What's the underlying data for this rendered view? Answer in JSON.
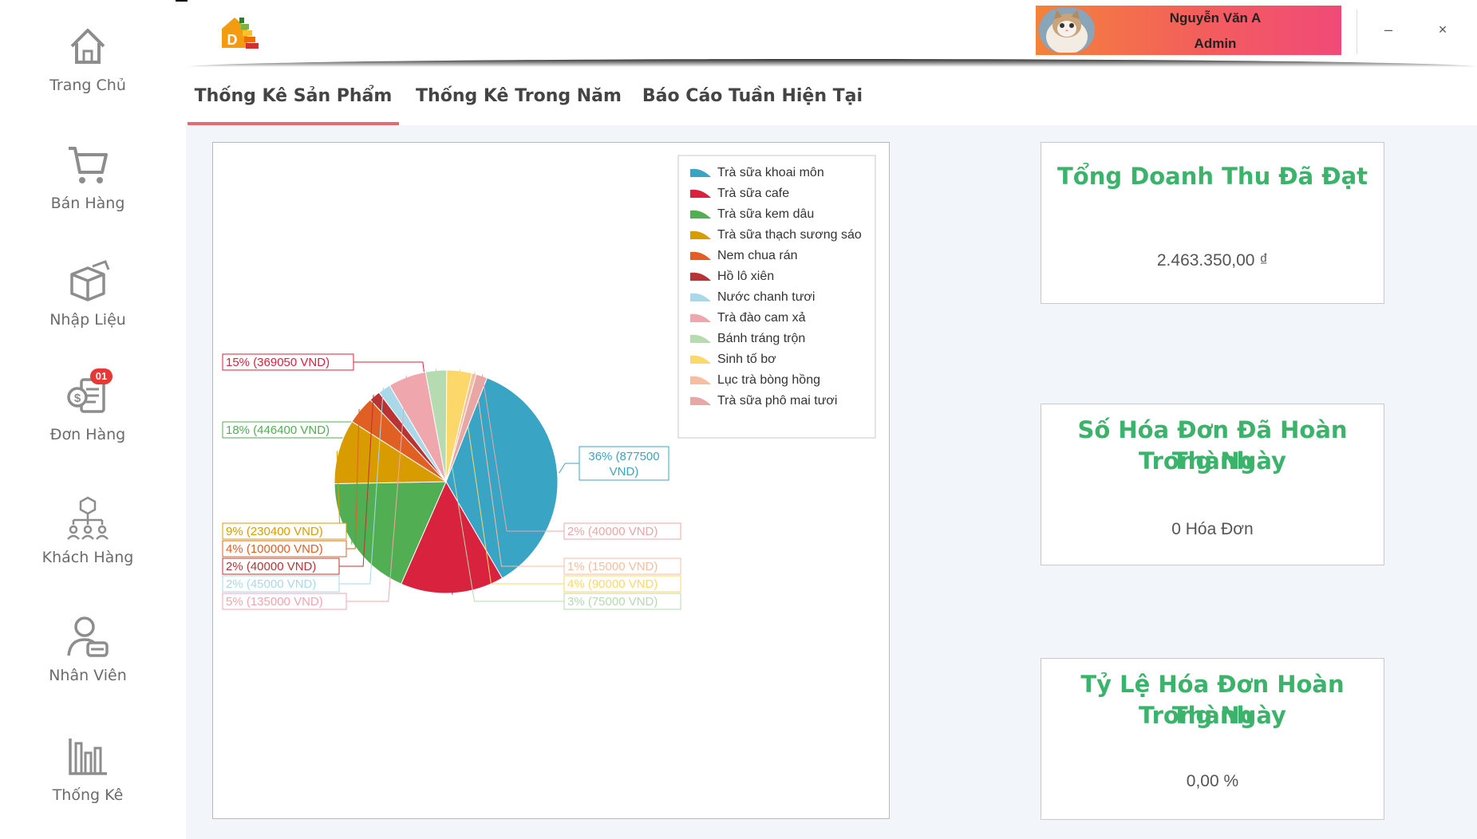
{
  "sidebar": {
    "items": [
      {
        "label": "Trang Chủ",
        "icon": "home-icon"
      },
      {
        "label": "Bán Hàng",
        "icon": "cart-icon"
      },
      {
        "label": "Nhập Liệu",
        "icon": "box-icon"
      },
      {
        "label": "Đơn Hàng",
        "icon": "invoice-icon",
        "badge": "01"
      },
      {
        "label": "Khách Hàng",
        "icon": "customers-icon"
      },
      {
        "label": "Nhân Viên",
        "icon": "employee-icon"
      },
      {
        "label": "Thống Kê",
        "icon": "statistics-icon"
      }
    ]
  },
  "header": {
    "user_name": "Nguyễn Văn A",
    "user_role": "Admin",
    "minimize_label": "–",
    "close_label": "×"
  },
  "tabs": [
    {
      "label": "Thống Kê Sản Phẩm",
      "active": true
    },
    {
      "label": "Thống Kê Trong Năm",
      "active": false
    },
    {
      "label": "Báo Cáo Tuần Hiện Tại",
      "active": false
    }
  ],
  "stats": {
    "revenue_title": "Tổng Doanh Thu Đã Đạt",
    "revenue_value": "2.463.350,00 ₫",
    "invoices_title_line1": "Số Hóa Đơn Đã Hoàn Thành",
    "invoices_title_line2": "Trong Ngày",
    "invoices_value": "0 Hóa Đơn",
    "rate_title_line1": "Tỷ Lệ Hóa Đơn Hoàn Thành",
    "rate_title_line2": "Trong Ngày",
    "rate_value": "0,00 %"
  },
  "chart_data": {
    "type": "pie",
    "series": [
      {
        "name": "Trà sữa khoai môn",
        "value": 877500,
        "label": "36% (877500 VND)",
        "color": "#3aa4c4"
      },
      {
        "name": "Trà sữa cafe",
        "value": 369050,
        "label": "15% (369050 VND)",
        "color": "#d9223e"
      },
      {
        "name": "Trà sữa kem dâu",
        "value": 446400,
        "label": "18% (446400 VND)",
        "color": "#52ae52"
      },
      {
        "name": "Trà sữa thạch sương sáo",
        "value": 230400,
        "label": "9% (230400 VND)",
        "color": "#d99c00"
      },
      {
        "name": "Nem chua rán",
        "value": 100000,
        "label": "4% (100000 VND)",
        "color": "#e06024"
      },
      {
        "name": "Hồ lô xiên",
        "value": 40000,
        "label": "2% (40000 VND)",
        "color": "#b83434"
      },
      {
        "name": "Nước chanh tươi",
        "value": 45000,
        "label": "2% (45000 VND)",
        "color": "#a9d9e8"
      },
      {
        "name": "Trà đào cam xả",
        "value": 135000,
        "label": "5% (135000 VND)",
        "color": "#f0a6ad"
      },
      {
        "name": "Bánh tráng trộn",
        "value": 75000,
        "label": "3% (75000 VND)",
        "color": "#b6dbb0"
      },
      {
        "name": "Sinh tố bơ",
        "value": 90000,
        "label": "4% (90000 VND)",
        "color": "#fcd76a"
      },
      {
        "name": "Lục trà bòng hồng",
        "value": 15000,
        "label": "1% (15000 VND)",
        "color": "#f5bea0"
      },
      {
        "name": "Trà sữa phô mai tươi",
        "value": 40000,
        "label": "2% (40000 VND)",
        "color": "#e8a7a5"
      }
    ],
    "legend_position": "top-right"
  }
}
